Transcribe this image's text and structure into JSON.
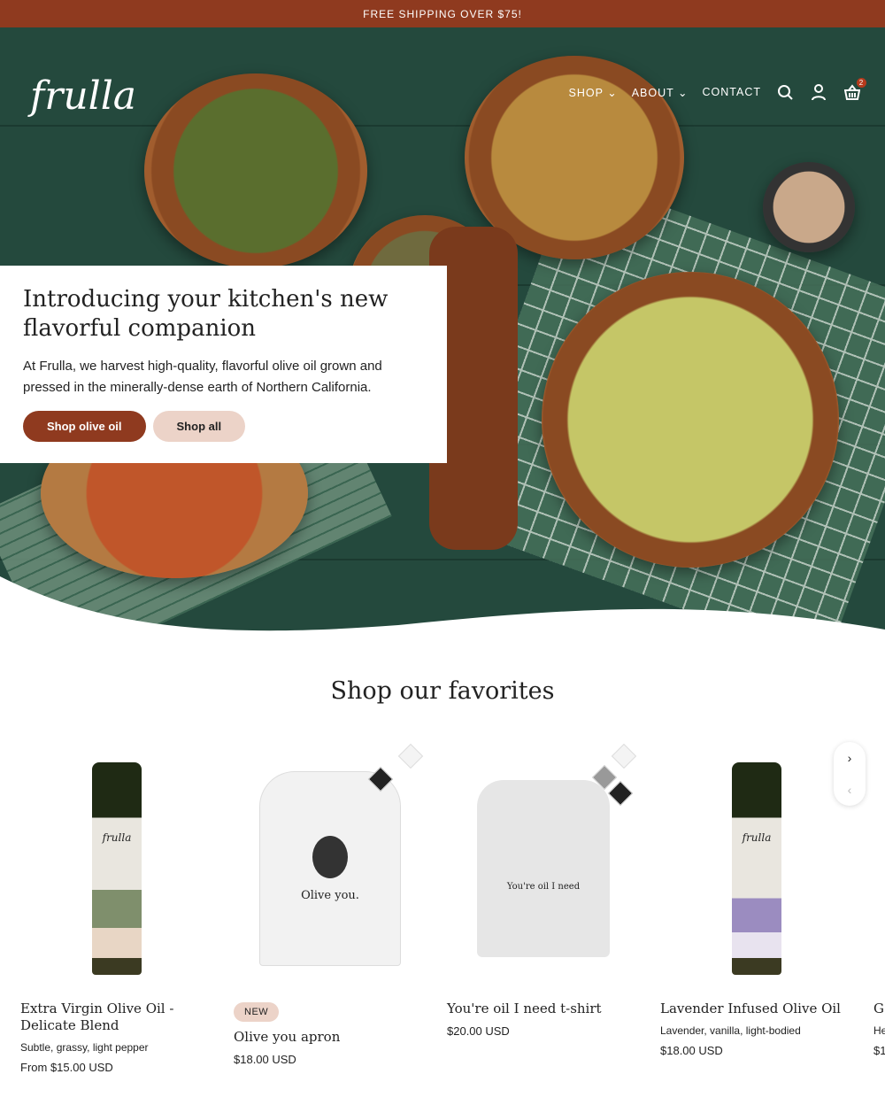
{
  "banner": {
    "text": "FREE SHIPPING OVER $75!"
  },
  "header": {
    "logo": "frulla",
    "nav": [
      {
        "label": "SHOP",
        "dropdown": true
      },
      {
        "label": "ABOUT",
        "dropdown": true
      },
      {
        "label": "CONTACT",
        "dropdown": false
      }
    ],
    "cart_count": "2"
  },
  "hero": {
    "title": "Introducing your kitchen's new flavorful companion",
    "body": "At Frulla, we harvest high-quality, flavorful olive oil grown and pressed in the minerally-dense earth of Northern California.",
    "primary_button": "Shop olive oil",
    "secondary_button": "Shop all"
  },
  "favorites": {
    "heading": "Shop our favorites",
    "products": [
      {
        "title": "Extra Virgin Olive Oil - Delicate Blend",
        "subtitle": "Subtle, grassy, light pepper",
        "price": "From $15.00 USD",
        "badge": "",
        "label": "frulla"
      },
      {
        "title": "Olive you apron",
        "subtitle": "",
        "price": "$18.00 USD",
        "badge": "NEW",
        "label": "Olive you."
      },
      {
        "title": "You're oil I need t-shirt",
        "subtitle": "",
        "price": "$20.00 USD",
        "badge": "",
        "label": "You're oil I need"
      },
      {
        "title": "Lavender Infused Olive Oil",
        "subtitle": "Lavender, vanilla, light-bodied",
        "price": "$18.00 USD",
        "badge": "",
        "label": "frulla"
      },
      {
        "title": "G",
        "subtitle": "He",
        "price": "$1",
        "badge": "",
        "label": ""
      }
    ]
  },
  "colors": {
    "brand": "#8f3a1f",
    "secondary": "#ecd3c8",
    "hero_bg": "#24493d"
  }
}
